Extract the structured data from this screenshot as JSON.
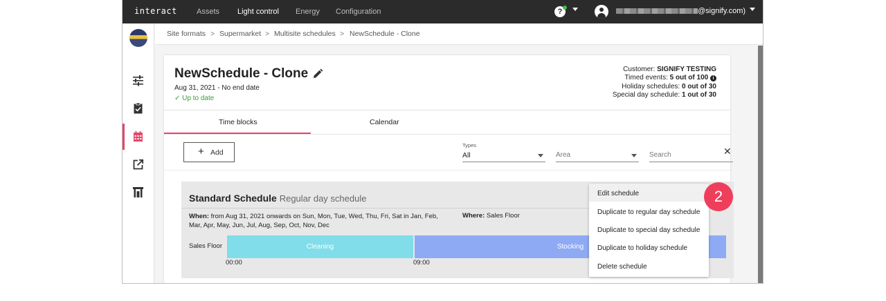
{
  "app": {
    "logo": "interact",
    "nav": [
      "Assets",
      "Light control",
      "Energy",
      "Configuration"
    ],
    "active_nav": "Light control",
    "help_icon": "?",
    "user_email_visible": "@signify.com)"
  },
  "breadcrumb": [
    "Site formats",
    "Supermarket",
    "Multisite schedules",
    "NewSchedule - Clone"
  ],
  "breadcrumb_sep": ">",
  "sidebar": {
    "icons": [
      "site-thumbnail",
      "sliders-icon",
      "clipboard-check-icon",
      "calendar-icon",
      "external-link-icon",
      "building-icon"
    ],
    "active": "calendar-icon"
  },
  "schedule": {
    "title": "NewSchedule - Clone",
    "date_range": "Aug 31, 2021 - No end date",
    "status_check": "✓",
    "status": "Up to date",
    "customer_label": "Customer:",
    "customer": "SIGNIFY TESTING",
    "timed_label": "Timed events:",
    "timed_value": "5 out of 100",
    "holiday_label": "Holiday schedules:",
    "holiday_value": "0 out of 30",
    "special_label": "Special day schedule:",
    "special_value": "1 out of 30"
  },
  "tabs": {
    "time_blocks": "Time blocks",
    "calendar": "Calendar",
    "active": "Time blocks"
  },
  "controls": {
    "add_icon": "+",
    "add_label": "Add",
    "types_label": "Types",
    "types_value": "All",
    "area_placeholder": "Area",
    "search_placeholder": "Search",
    "clear_icon": "✕"
  },
  "block": {
    "name": "Standard Schedule",
    "subtitle": "Regular day schedule",
    "when_label": "When:",
    "when_text": "from Aug 31, 2021 onwards on Sun, Mon, Tue, Wed, Thu, Fri, Sat in Jan, Feb, Mar, Apr, May, Jun, Jul, Aug, Sep, Oct, Nov, Dec",
    "where_label": "Where:",
    "where_text": "Sales Floor",
    "row_label": "Sales Floor",
    "segments": [
      "Cleaning",
      "Stocking"
    ],
    "times": [
      "00:00",
      "09:00"
    ]
  },
  "context_menu": [
    "Edit schedule",
    "Duplicate to regular day schedule",
    "Duplicate to special day schedule",
    "Duplicate to holiday schedule",
    "Delete schedule"
  ],
  "callout": "2",
  "colors": {
    "accent": "#e5476a",
    "cleaning": "#80dde9",
    "stocking": "#8faaf4",
    "callout": "#ef3e5c",
    "topbar": "#2b2b2b",
    "ok_green": "#3a9a3a"
  }
}
